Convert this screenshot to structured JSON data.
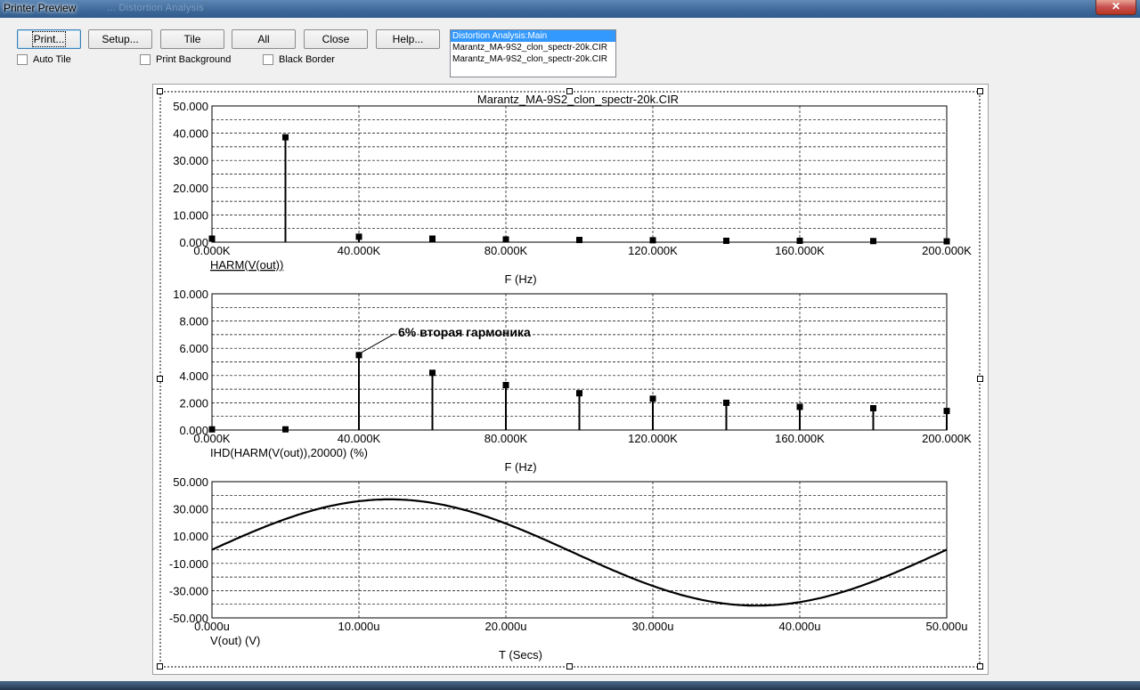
{
  "window": {
    "title": "Printer Preview",
    "ghost_title": "... Distortion Analysis"
  },
  "toolbar": {
    "buttons": [
      "Print...",
      "Setup...",
      "Tile",
      "All",
      "Close",
      "Help..."
    ],
    "checkboxes": [
      {
        "label": "Auto Tile",
        "checked": false
      },
      {
        "label": "Print Background",
        "checked": false
      },
      {
        "label": "Black Border",
        "checked": false
      }
    ]
  },
  "listbox": {
    "items": [
      "Distortion Analysis:Main",
      "Marantz_MA-9S2_clon_spectr-20k.CIR",
      "Marantz_MA-9S2_clon_spectr-20k.CIR"
    ],
    "selected_index": 0
  },
  "page_title": "Marantz_MA-9S2_clon_spectr-20k.CIR",
  "chart_data": [
    {
      "type": "bar",
      "ylabel": "HARM(V(out))",
      "xlabel": "F (Hz)",
      "yticks": [
        "50.000",
        "40.000",
        "30.000",
        "20.000",
        "10.000",
        "0.000"
      ],
      "xticks": [
        "0.000K",
        "40.000K",
        "80.000K",
        "120.000K",
        "160.000K",
        "200.000K"
      ],
      "ylim": [
        0,
        50
      ],
      "xlim": [
        0,
        200000
      ],
      "x": [
        0,
        20000,
        40000,
        60000,
        80000,
        100000,
        120000,
        140000,
        160000,
        180000,
        200000
      ],
      "values": [
        1.3,
        38.5,
        2.0,
        1.3,
        1.0,
        0.8,
        0.7,
        0.5,
        0.5,
        0.4,
        0.3
      ]
    },
    {
      "type": "bar",
      "ylabel": "IHD(HARM(V(out)),20000) (%)",
      "xlabel": "F (Hz)",
      "yticks": [
        "10.000",
        "8.000",
        "6.000",
        "4.000",
        "2.000",
        "0.000"
      ],
      "xticks": [
        "0.000K",
        "40.000K",
        "80.000K",
        "120.000K",
        "160.000K",
        "200.000K"
      ],
      "ylim": [
        0,
        10
      ],
      "xlim": [
        0,
        200000
      ],
      "x": [
        0,
        20000,
        40000,
        60000,
        80000,
        100000,
        120000,
        140000,
        160000,
        180000,
        200000
      ],
      "values": [
        0.05,
        0.05,
        5.5,
        4.2,
        3.3,
        2.7,
        2.3,
        2.0,
        1.7,
        1.6,
        1.4
      ],
      "annotation": {
        "text": "6% вторая гармоника",
        "x": 40000,
        "y": 5.5
      }
    },
    {
      "type": "line",
      "ylabel": "V(out) (V)",
      "xlabel": "T (Secs)",
      "yticks": [
        "50.000",
        "30.000",
        "10.000",
        "-10.000",
        "-30.000",
        "-50.000"
      ],
      "xticks": [
        "0.000u",
        "10.000u",
        "20.000u",
        "30.000u",
        "40.000u",
        "50.000u"
      ],
      "ylim": [
        -50,
        50
      ],
      "xlim": [
        0,
        50
      ],
      "series": [
        {
          "amplitude": 39,
          "frequency_khz": 20,
          "offset": -2,
          "phase_deg": 3
        }
      ]
    }
  ]
}
